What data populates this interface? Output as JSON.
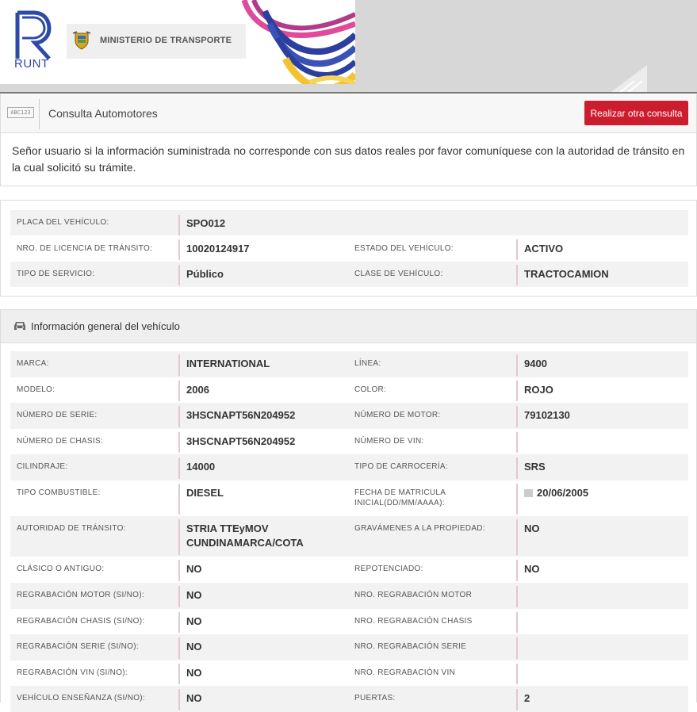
{
  "header": {
    "logo_text": "RUNT",
    "ministry": "MINISTERIO DE TRANSPORTE"
  },
  "toolbar": {
    "icon_text": "ABC123",
    "title": "Consulta Automotores",
    "button": "Realizar otra consulta"
  },
  "notice": "Señor usuario si la información suministrada no corresponde con sus datos reales por favor comuníquese con la autoridad de tránsito en la cual solicitó su trámite.",
  "summary": {
    "placa_label": "PLACA DEL VEHÍCULO:",
    "placa": "SPO012",
    "licencia_label": "NRO. DE LICENCIA DE TRÁNSITO:",
    "licencia": "10020124917",
    "estado_label": "ESTADO DEL VEHÍCULO:",
    "estado": "ACTIVO",
    "servicio_label": "TIPO DE SERVICIO:",
    "servicio": "Público",
    "clase_label": "CLASE DE VEHÍCULO:",
    "clase": "TRACTOCAMION"
  },
  "general": {
    "title": "Información general del vehículo",
    "rows": [
      {
        "l1": "MARCA:",
        "v1": "INTERNATIONAL",
        "l2": "LÍNEA:",
        "v2": "9400"
      },
      {
        "l1": "MODELO:",
        "v1": "2006",
        "l2": "COLOR:",
        "v2": "ROJO"
      },
      {
        "l1": "NÚMERO DE SERIE:",
        "v1": "3HSCNAPT56N204952",
        "l2": "NÚMERO DE MOTOR:",
        "v2": "79102130"
      },
      {
        "l1": "NÚMERO DE CHASIS:",
        "v1": "3HSCNAPT56N204952",
        "l2": "NÚMERO DE VIN:",
        "v2": ""
      },
      {
        "l1": "CILINDRAJE:",
        "v1": "14000",
        "l2": "TIPO DE CARROCERÍA:",
        "v2": "SRS"
      },
      {
        "l1": "TIPO COMBUSTIBLE:",
        "v1": "DIESEL",
        "l2": "FECHA DE MATRICULA INICIAL(DD/MM/AAAA):",
        "v2": "20/06/2005"
      },
      {
        "l1": "AUTORIDAD DE TRÁNSITO:",
        "v1": "STRIA TTEyMOV CUNDINAMARCA/COTA",
        "l2": "GRAVÁMENES A LA PROPIEDAD:",
        "v2": "NO"
      },
      {
        "l1": "CLÁSICO O ANTIGUO:",
        "v1": "NO",
        "l2": "REPOTENCIADO:",
        "v2": "NO"
      },
      {
        "l1": "REGRABACIÓN MOTOR (SI/NO):",
        "v1": "NO",
        "l2": "NRO. REGRABACIÓN MOTOR",
        "v2": ""
      },
      {
        "l1": "REGRABACIÓN CHASIS (SI/NO):",
        "v1": "NO",
        "l2": "NRO. REGRABACIÓN CHASIS",
        "v2": ""
      },
      {
        "l1": "REGRABACIÓN SERIE (SI/NO):",
        "v1": "NO",
        "l2": "NRO. REGRABACIÓN SERIE",
        "v2": ""
      },
      {
        "l1": "REGRABACIÓN VIN (SI/NO):",
        "v1": "NO",
        "l2": "NRO. REGRABACIÓN VIN",
        "v2": ""
      },
      {
        "l1": "VEHÍCULO ENSEÑANZA (SI/NO):",
        "v1": "NO",
        "l2": "PUERTAS:",
        "v2": "2"
      }
    ]
  }
}
